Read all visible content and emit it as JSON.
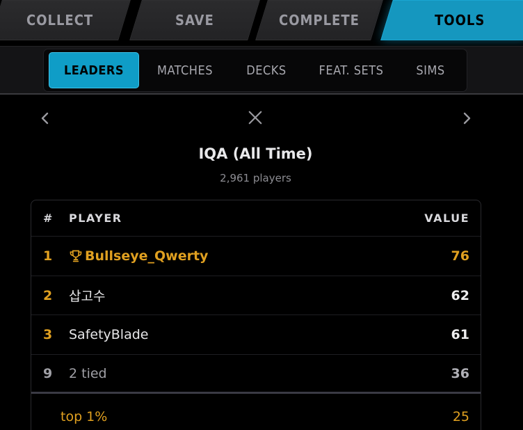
{
  "top_tabs": [
    {
      "label": "COLLECT",
      "active": false
    },
    {
      "label": "SAVE",
      "active": false
    },
    {
      "label": "COMPLETE",
      "active": false
    },
    {
      "label": "TOOLS",
      "active": true
    }
  ],
  "sub_tabs": [
    {
      "label": "LEADERS",
      "active": true
    },
    {
      "label": "MATCHES",
      "active": false
    },
    {
      "label": "DECKS",
      "active": false
    },
    {
      "label": "FEAT. SETS",
      "active": false
    },
    {
      "label": "SIMS",
      "active": false
    }
  ],
  "header": {
    "title": "IQA (All Time)",
    "subtitle": "2,961 players",
    "icons": [
      "chevron-left-icon",
      "close-icon",
      "chevron-right-icon"
    ]
  },
  "table": {
    "columns": {
      "rank": "#",
      "player": "PLAYER",
      "value": "VALUE"
    },
    "rows": [
      {
        "rank": "1",
        "player": "Bullseye_Qwerty",
        "value": "76",
        "icon": "trophy-icon"
      },
      {
        "rank": "2",
        "player": "삽고수",
        "value": "62"
      },
      {
        "rank": "3",
        "player": "SafetyBlade",
        "value": "61"
      },
      {
        "rank": "9",
        "player": "2 tied",
        "value": "36"
      }
    ],
    "percentile": {
      "label": "top 1%",
      "value": "25"
    }
  },
  "colors": {
    "accent": "#1597bf",
    "gold": "#e0a020",
    "background": "#000000"
  }
}
